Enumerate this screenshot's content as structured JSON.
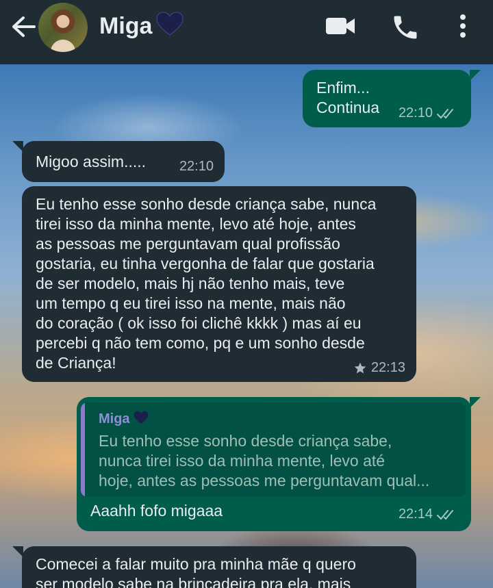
{
  "header": {
    "contact_name": "Miga",
    "heart": "🖤"
  },
  "messages": [
    {
      "direction": "outgoing",
      "text": "Enfim...\nContinua",
      "time": "22:10",
      "status": "read"
    },
    {
      "direction": "incoming",
      "text": "Migoo assim.....",
      "time": "22:10"
    },
    {
      "direction": "incoming",
      "text": "Eu tenho esse sonho desde criança sabe, nunca\ntirei isso da minha mente, levo até hoje, antes\nas pessoas me perguntavam qual profissão\ngostaria, eu tinha vergonha de falar que gostaria\nde ser modelo, mais hj não tenho mais, teve\num tempo q eu tirei isso na mente, mais não\ndo coração ( ok isso foi clichê kkkk ) mas aí eu\npercebi q não tem como, pq e um sonho desde\nde Criança!",
      "time": "22:13",
      "starred": true
    },
    {
      "direction": "outgoing",
      "reply_to": {
        "name": "Miga",
        "heart": "🖤",
        "text": "Eu tenho esse sonho desde criança sabe,\nnunca tirei isso da minha mente, levo até\nhoje, antes as pessoas me perguntavam qual..."
      },
      "text": "Aaahh fofo migaaa",
      "time": "22:14",
      "status": "read"
    },
    {
      "direction": "incoming",
      "text": "Comecei a falar muito pra minha mãe q quero\nser modelo sabe na brincadeira pra ela, mais"
    }
  ],
  "colors": {
    "header_bg": "#1f2c34",
    "outgoing_bubble": "#005c4b",
    "incoming_bubble": "#1f2c34",
    "quote_accent": "#8f7ad0",
    "read_ticks": "#a6c9c1"
  },
  "icons": [
    "back-arrow-icon",
    "video-call-icon",
    "phone-icon",
    "more-options-icon",
    "double-check-icon",
    "star-icon"
  ]
}
